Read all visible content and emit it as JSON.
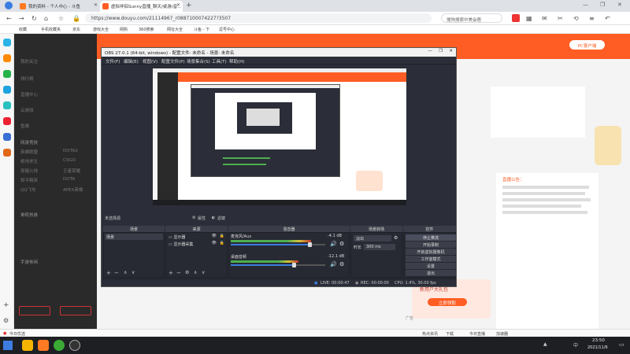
{
  "browser": {
    "tabs": [
      {
        "label": "我的资料 - 个人中心 - 斗鱼",
        "active": false
      },
      {
        "label": "虚拟伴侣Sunny直播_聊天/桌游/音...",
        "active": true
      }
    ],
    "url": "https://www.douyu.com/21114967_r0887100074227?3507",
    "url_secure": "https://",
    "search_placeholder": "搜狗搜索中美会晤",
    "bookmarks": [
      "收藏",
      "手机收藏夹",
      "京东",
      "游戏大全",
      "网购",
      "360搜索",
      "网址大全",
      "斗鱼 - 下",
      "逗号中心"
    ]
  },
  "douyu": {
    "sidebar": [
      "我的关注",
      "排行榜",
      "直播中心",
      "云游戏",
      "鱼塘"
    ],
    "categories_header": "网游竞技",
    "categories": [
      [
        "英雄联盟",
        "DOTA2"
      ],
      [
        "绝地求生",
        "CSGO"
      ],
      [
        "穿越火线",
        "王者荣耀"
      ],
      [
        "和平精英",
        "DOTA"
      ],
      [
        "QQ飞车",
        "APEX英雄"
      ]
    ],
    "categories2_header": "单机热游",
    "categories3_header": "手游休闲",
    "pc_badge": "PC客户端",
    "ad_label": "广告",
    "gift_title": "新用户大礼包",
    "gift_button": "立即领取",
    "announcement_label": "直播公告："
  },
  "obs": {
    "title": "OBS 27.0.1 (64-bit, windows) - 配置文件: 未命名 - 场景: 未命名",
    "menu": [
      "文件(F)",
      "编辑(E)",
      "视图(V)",
      "配置文件(P)",
      "场景集合(S)",
      "工具(T)",
      "帮助(H)"
    ],
    "source_label": "未选择源",
    "source_buttons": [
      "属性",
      "滤镜"
    ],
    "docks": {
      "scenes": {
        "title": "场景",
        "items": [
          "场景"
        ]
      },
      "sources": {
        "title": "来源",
        "items": [
          "显示器",
          "显示器采集"
        ]
      },
      "mixer": {
        "title": "混音器",
        "channels": [
          {
            "name": "麦克风/Aux",
            "level": "-4.1 dB",
            "level_frac": 0.85
          },
          {
            "name": "桌面音频",
            "level": "-12.1 dB",
            "level_frac": 0.72
          }
        ]
      },
      "transitions": {
        "title": "场景转场",
        "type": "淡出",
        "duration_label": "时长",
        "duration": "300 ms"
      },
      "controls": {
        "title": "控件",
        "buttons": [
          "停止推流",
          "开始录制",
          "开启虚拟摄像机",
          "工作室模式",
          "设置",
          "退出"
        ]
      }
    },
    "status": {
      "live": "LIVE: 00:00:47",
      "rec": "REC: 00:00:00",
      "cpu": "CPU: 1.4%, 30.00 fps"
    }
  },
  "taskbar": {
    "time": "23:50",
    "date": "2021/11/6",
    "lang": "中"
  },
  "download_bar": "今日优选",
  "download_items": [
    "热点资讯",
    "下载",
    "今日直播",
    "加速器"
  ],
  "colors": {
    "douyu_orange": "#ff5d23",
    "obs_bg": "#2b2e38",
    "taskbar": "#1d1f23"
  }
}
